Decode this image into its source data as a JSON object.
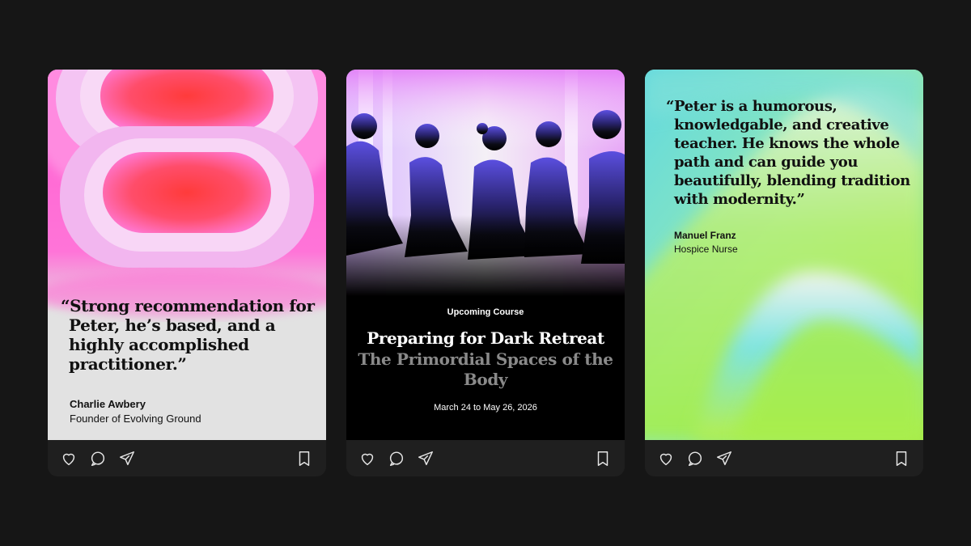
{
  "cards": [
    {
      "quote": "“Strong recommendation for Peter, he’s based, and a highly accomplished practitioner.”",
      "author_name": "Charlie Awbery",
      "author_role": "Founder of Evolving Ground",
      "accent_colors": [
        "#ff4b4b",
        "#ff5fd0",
        "#e2e2e2"
      ]
    },
    {
      "label": "Upcoming Course",
      "title": "Preparing for Dark Retreat",
      "subtitle": "The Primordial Spaces of the Body",
      "date": "March 24 to May 26, 2026",
      "accent_colors": [
        "#000000",
        "#6a5cff",
        "#8a8a8a"
      ]
    },
    {
      "quote": "“Peter is a humorous, knowledgable, and creative teacher. He knows the whole path and can guide you beautifully, blending tradition with modernity.”",
      "author_name": "Manuel Franz",
      "author_role": "Hospice Nurse",
      "accent_colors": [
        "#7be3d8",
        "#a6f03c",
        "#7ad8ff"
      ]
    }
  ],
  "actions": {
    "icons": [
      "heart-icon",
      "comment-icon",
      "send-icon",
      "bookmark-icon"
    ],
    "icon_color": "#e6e6e6"
  }
}
